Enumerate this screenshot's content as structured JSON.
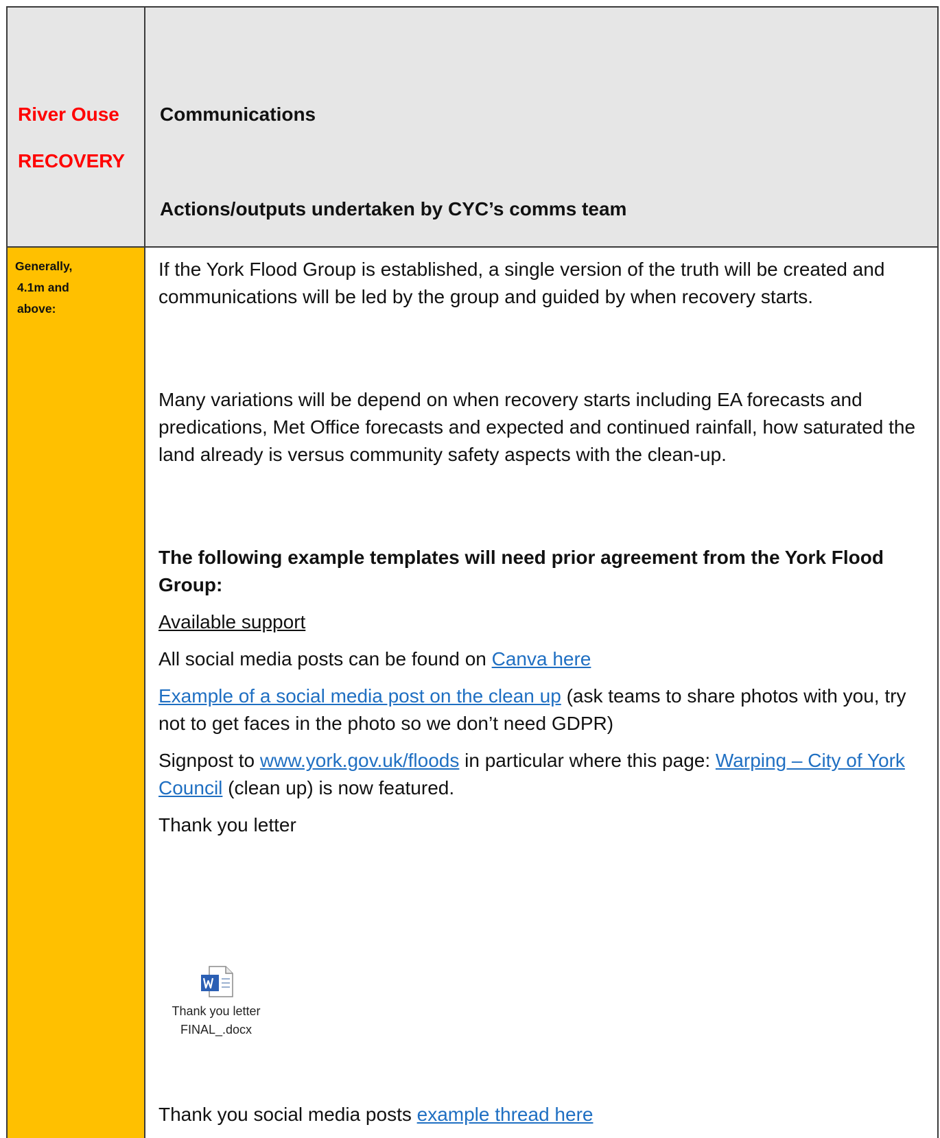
{
  "header": {
    "river_title": "River Ouse",
    "phase": "RECOVERY",
    "section": "Communications",
    "subtitle": "Actions/outputs undertaken by CYC’s comms team"
  },
  "sidebar": {
    "label_line1": "Generally,",
    "label_line2": "4.1m and",
    "label_line3": "above:"
  },
  "content": {
    "para1": "If the York Flood Group is established, a single version of the truth will be created and communications will be led by the group and guided by when recovery starts.",
    "para2": "Many variations will be depend on when recovery starts including EA forecasts and predications, Met Office forecasts and expected and continued rainfall, how saturated the land already is versus community safety aspects with the clean-up.",
    "bold_heading": "The following example templates will need prior agreement from the York Flood Group:",
    "available_support": "Available support",
    "social_prefix": "All social media posts can be found on ",
    "canva_link": "Canva here",
    "example_link": "Example of a social media post on the clean up",
    "example_suffix": " (ask teams to share photos with you, try not to get faces in the photo so we don’t need GDPR)",
    "signpost_prefix": "Signpost to ",
    "floods_link": "www.york.gov.uk/floods",
    "signpost_mid": " in particular where this page: ",
    "warping_link": "Warping – City of York Council",
    "signpost_suffix": " (clean up) is now featured.",
    "thank_you_letter": "Thank you letter",
    "attachment_line1": "Thank you letter",
    "attachment_line2": "FINAL_.docx",
    "thanks_posts_prefix": "Thank you social media posts ",
    "thread_link": "example thread here"
  },
  "colors": {
    "header_bg": "#e6e6e6",
    "sidebar_bg": "#ffc000",
    "red_text": "#ff0000",
    "link": "#1f6fc2"
  },
  "icons": {
    "attachment": "word-document-icon"
  }
}
